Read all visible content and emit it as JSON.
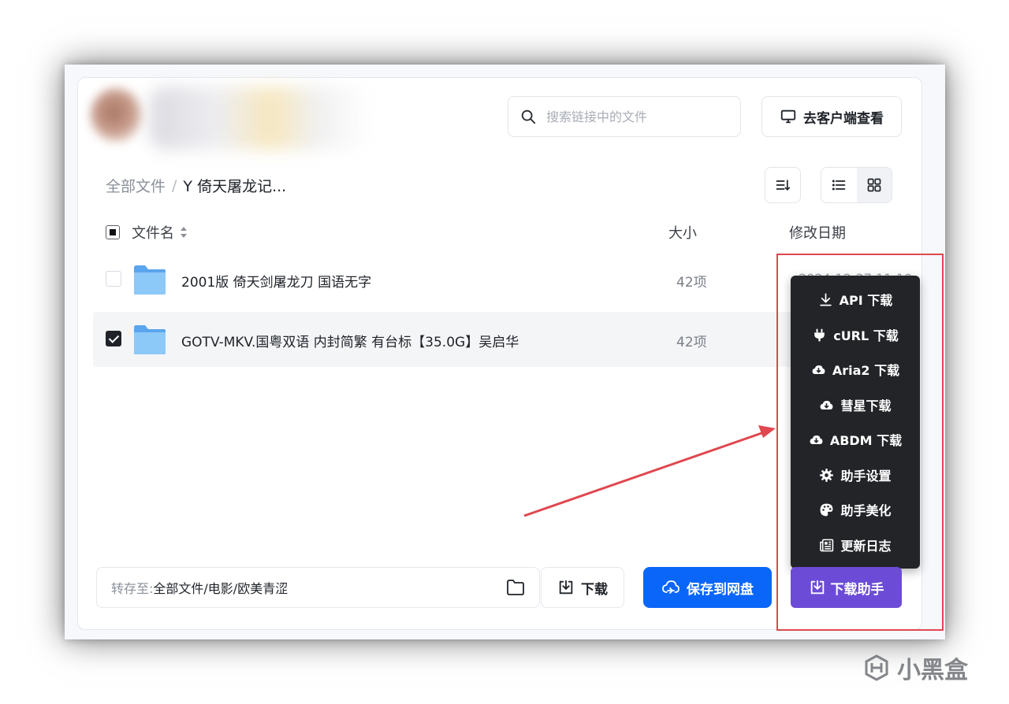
{
  "header": {
    "search_placeholder": "搜索链接中的文件",
    "client_button": "去客户端查看"
  },
  "breadcrumb": {
    "root": "全部文件",
    "separator": "/",
    "current": "Y 倚天屠龙记..."
  },
  "table": {
    "columns": {
      "name": "文件名",
      "size": "大小",
      "modified": "修改日期"
    },
    "rows": [
      {
        "name": "2001版 倚天剑屠龙刀 国语无字",
        "size": "42项",
        "date": "2024-12-27 11:10",
        "checked": false
      },
      {
        "name": "GOTV-MKV.国粤双语 内封简繁 有台标【35.0G】吴启华",
        "size": "42项",
        "checked": true
      }
    ]
  },
  "footer": {
    "save_to_label": "转存至:",
    "save_to_path": "全部文件/电影/欧美青涩",
    "download_button": "下载",
    "save_button": "保存到网盘",
    "helper_button": "下载助手"
  },
  "helper_menu": {
    "items": [
      {
        "label": "API 下载",
        "icon": "download-icon"
      },
      {
        "label": "cURL 下载",
        "icon": "plug-icon"
      },
      {
        "label": "Aria2 下载",
        "icon": "cloud-download-icon"
      },
      {
        "label": "彗星下载",
        "icon": "cloud-download-icon"
      },
      {
        "label": "ABDM 下载",
        "icon": "cloud-download-icon"
      },
      {
        "label": "助手设置",
        "icon": "gear-icon"
      },
      {
        "label": "助手美化",
        "icon": "palette-icon"
      },
      {
        "label": "更新日志",
        "icon": "newspaper-icon"
      }
    ]
  },
  "watermark": {
    "text": "小黑盒"
  },
  "colors": {
    "primary": "#0a66f8",
    "helper": "#6c4cd6",
    "annotation": "#e0474f",
    "menu_bg": "#222428"
  }
}
